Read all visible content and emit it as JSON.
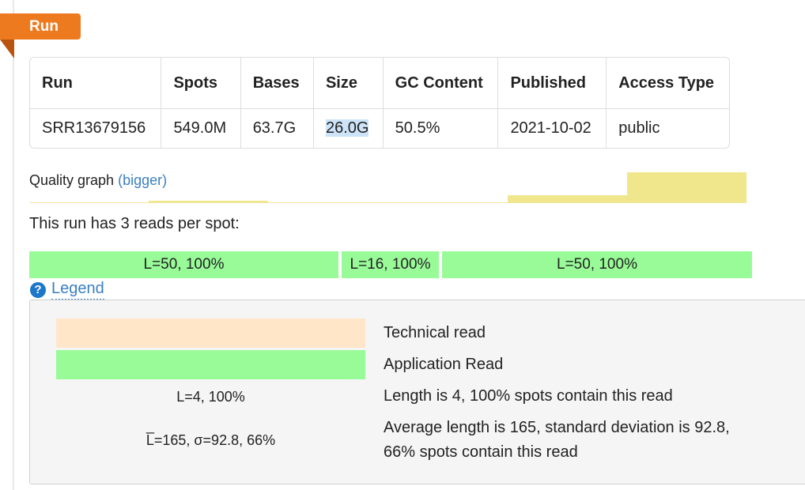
{
  "section_tab": "Run",
  "table": {
    "headers": [
      "Run",
      "Spots",
      "Bases",
      "Size",
      "GC Content",
      "Published",
      "Access Type"
    ],
    "row": [
      "SRR13679156",
      "549.0M",
      "63.7G",
      "26.0G",
      "50.5%",
      "2021-10-02",
      "public"
    ]
  },
  "quality": {
    "label": "Quality graph",
    "link": "(bigger)"
  },
  "reads": {
    "title": "This run has 3 reads per spot:",
    "bars": [
      "L=50, 100%",
      "L=16, 100%",
      "L=50, 100%"
    ]
  },
  "legend": {
    "toggle": "Legend",
    "technical": "Technical read",
    "application": "Application Read",
    "length_sample": "L=4, 100%",
    "length_desc": "Length is 4, 100% spots contain this read",
    "avg_sample": "L̅=165, σ=92.8, 66%",
    "avg_desc_line1": "Average length is 165, standard deviation is 92.8,",
    "avg_desc_line2": "66% spots contain this read"
  },
  "colors": {
    "tab": "#ee7a1f",
    "technical_read": "#ffe6c9",
    "application_read": "#98fb98",
    "quality_bar": "#f0e68c",
    "link": "#3a7fc1"
  }
}
